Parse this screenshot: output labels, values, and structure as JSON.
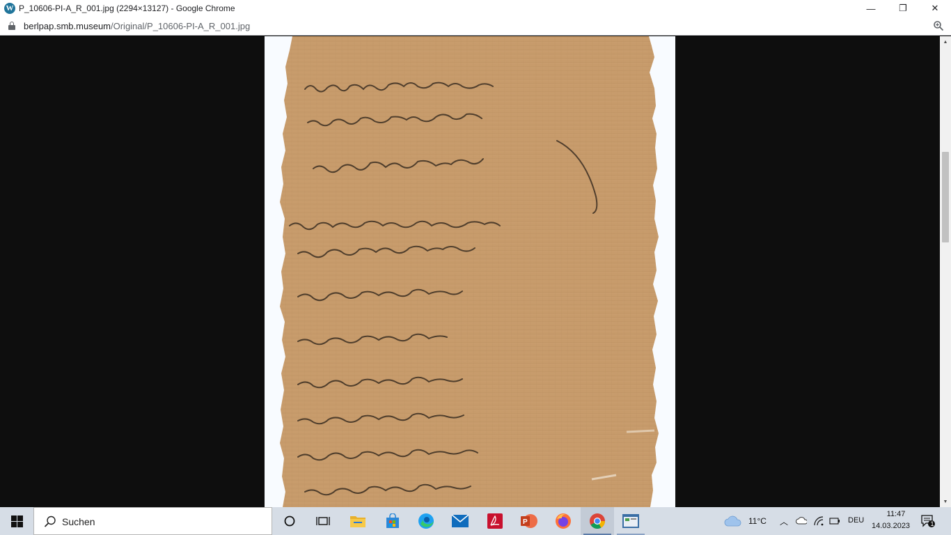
{
  "window": {
    "title": "P_10606-PI-A_R_001.jpg (2294×13127) - Google Chrome",
    "min_glyph": "—",
    "max_glyph": "❐",
    "close_glyph": "✕"
  },
  "address": {
    "host": "berlpap.smb.museum",
    "path": "/Original/P_10606-PI-A_R_001.jpg"
  },
  "viewer": {
    "image": "papyrus-manuscript-photo",
    "scroll_up": "▲",
    "scroll_down": "▼"
  },
  "taskbar": {
    "search_placeholder": "Suchen",
    "apps": [
      "task-view",
      "file-explorer",
      "microsoft-store",
      "edge",
      "mail",
      "acrobat",
      "powerpoint",
      "firefox",
      "chrome",
      "app-window"
    ],
    "weather_temp": "11°C",
    "language": "DEU",
    "time": "11:47",
    "date": "14.03.2023",
    "notification_count": "1",
    "colors": {
      "chrome_active_bg": "#c3cbd6",
      "taskbar_bg": "#d6dde6"
    }
  }
}
